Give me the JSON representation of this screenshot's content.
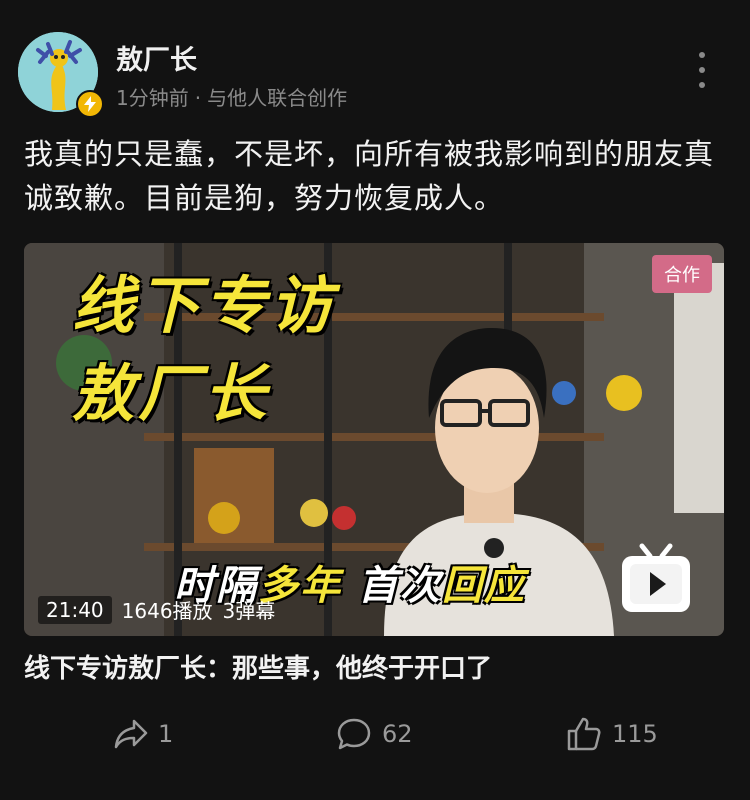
{
  "author": {
    "name": "敖厂长",
    "time": "1分钟前",
    "separator": "·",
    "collab_note": "与他人联合创作"
  },
  "post": {
    "text": "我真的只是蠢，不是坏，向所有被我影响到的朋友真诚致歉。目前是狗，努力恢复成人。"
  },
  "video": {
    "badge": "合作",
    "overlay_line1": "线下专访",
    "overlay_line2": "敖厂长",
    "overlay_bottom_a": "时隔",
    "overlay_bottom_b": "多年",
    "overlay_bottom_c": " 首次",
    "overlay_bottom_d": "回应",
    "duration": "21:40",
    "plays": "1646播放",
    "danmaku": "3弹幕",
    "logo_icon": "bilibili-tv-icon"
  },
  "caption": "线下专访敖厂长：那些事，他终于开口了",
  "actions": {
    "share_count": "1",
    "comment_count": "62",
    "like_count": "115"
  },
  "colors": {
    "background": "#121212",
    "collab_badge": "#d36b88",
    "title_yellow": "#f5e53a"
  }
}
